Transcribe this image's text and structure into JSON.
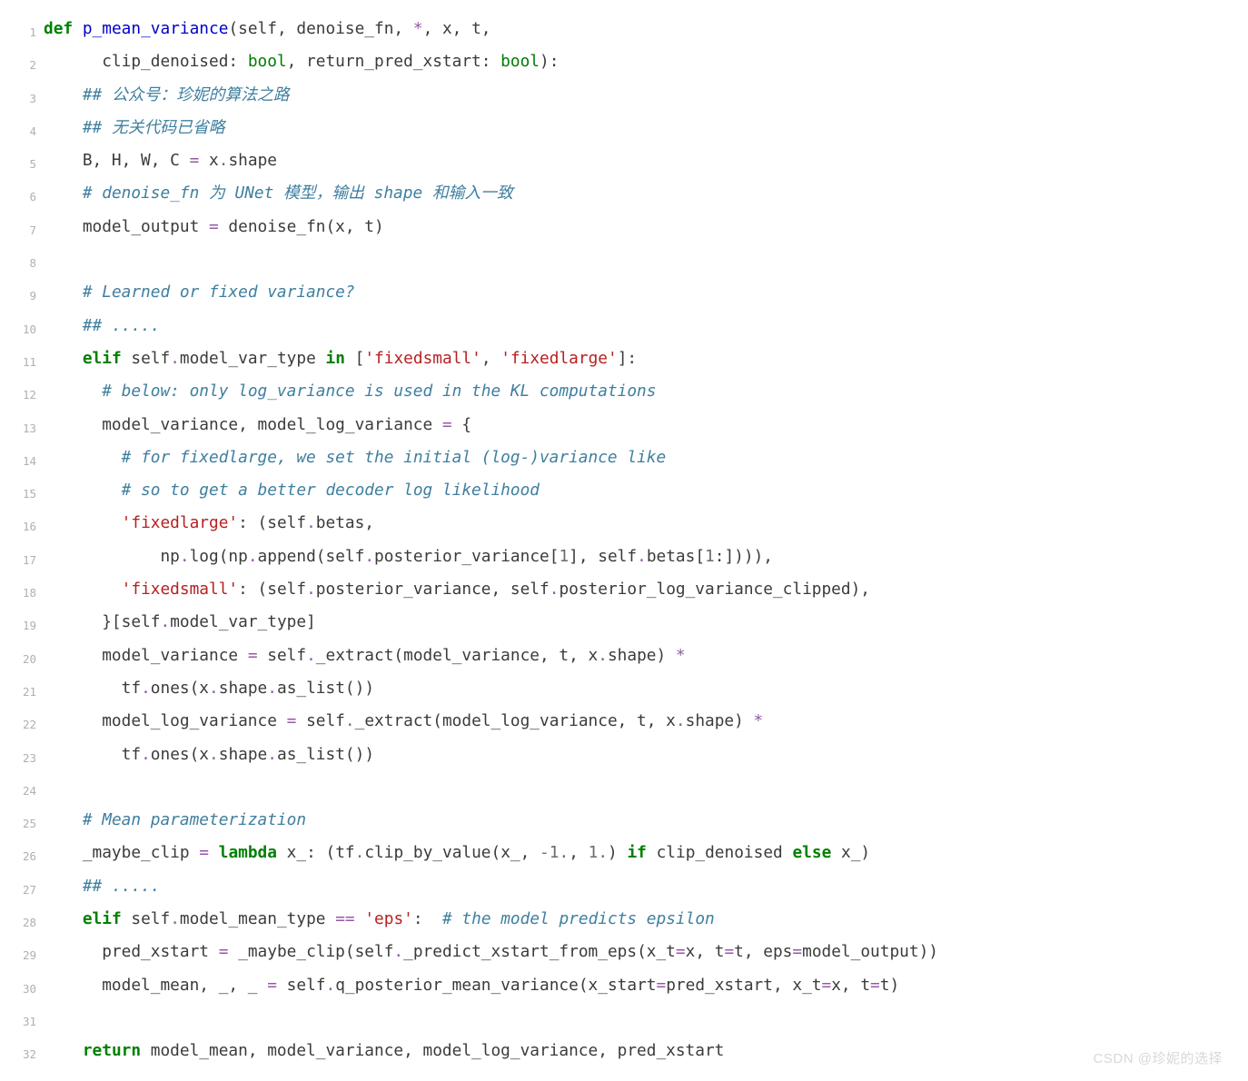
{
  "watermark": "CSDN @珍妮的选择",
  "lines": [
    {
      "n": "1",
      "segs": [
        {
          "c": "tok-kw",
          "t": "def"
        },
        {
          "c": "tok-id",
          "t": " "
        },
        {
          "c": "tok-fn",
          "t": "p_mean_variance"
        },
        {
          "c": "tok-id",
          "t": "(self, denoise_fn, "
        },
        {
          "c": "tok-op",
          "t": "*"
        },
        {
          "c": "tok-id",
          "t": ", x, t,"
        }
      ]
    },
    {
      "n": "2",
      "segs": [
        {
          "c": "tok-id",
          "t": "      clip_denoised: "
        },
        {
          "c": "tok-typ",
          "t": "bool"
        },
        {
          "c": "tok-id",
          "t": ", return_pred_xstart: "
        },
        {
          "c": "tok-typ",
          "t": "bool"
        },
        {
          "c": "tok-id",
          "t": "):"
        }
      ]
    },
    {
      "n": "3",
      "segs": [
        {
          "c": "tok-id",
          "t": "    "
        },
        {
          "c": "tok-cmt",
          "t": "## 公众号：珍妮的算法之路"
        }
      ]
    },
    {
      "n": "4",
      "segs": [
        {
          "c": "tok-id",
          "t": "    "
        },
        {
          "c": "tok-cmt",
          "t": "## 无关代码已省略"
        }
      ]
    },
    {
      "n": "5",
      "segs": [
        {
          "c": "tok-id",
          "t": "    B, H, W, C "
        },
        {
          "c": "tok-op",
          "t": "="
        },
        {
          "c": "tok-id",
          "t": " x"
        },
        {
          "c": "tok-op",
          "t": "."
        },
        {
          "c": "tok-id",
          "t": "shape"
        }
      ]
    },
    {
      "n": "6",
      "segs": [
        {
          "c": "tok-id",
          "t": "    "
        },
        {
          "c": "tok-cmt",
          "t": "# denoise_fn 为 UNet 模型，输出 shape 和输入一致"
        }
      ]
    },
    {
      "n": "7",
      "segs": [
        {
          "c": "tok-id",
          "t": "    model_output "
        },
        {
          "c": "tok-op",
          "t": "="
        },
        {
          "c": "tok-id",
          "t": " denoise_fn(x, t)"
        }
      ]
    },
    {
      "n": "8",
      "segs": [
        {
          "c": "tok-id",
          "t": " "
        }
      ]
    },
    {
      "n": "9",
      "segs": [
        {
          "c": "tok-id",
          "t": "    "
        },
        {
          "c": "tok-cmt",
          "t": "# Learned or fixed variance?"
        }
      ]
    },
    {
      "n": "10",
      "segs": [
        {
          "c": "tok-id",
          "t": "    "
        },
        {
          "c": "tok-cmt",
          "t": "## ....."
        }
      ]
    },
    {
      "n": "11",
      "segs": [
        {
          "c": "tok-id",
          "t": "    "
        },
        {
          "c": "tok-kw",
          "t": "elif"
        },
        {
          "c": "tok-id",
          "t": " self"
        },
        {
          "c": "tok-op",
          "t": "."
        },
        {
          "c": "tok-id",
          "t": "model_var_type "
        },
        {
          "c": "tok-kw",
          "t": "in"
        },
        {
          "c": "tok-id",
          "t": " ["
        },
        {
          "c": "tok-str",
          "t": "'fixedsmall'"
        },
        {
          "c": "tok-id",
          "t": ", "
        },
        {
          "c": "tok-str",
          "t": "'fixedlarge'"
        },
        {
          "c": "tok-id",
          "t": "]:"
        }
      ]
    },
    {
      "n": "12",
      "segs": [
        {
          "c": "tok-id",
          "t": "      "
        },
        {
          "c": "tok-cmt",
          "t": "# below: only log_variance is used in the KL computations"
        }
      ]
    },
    {
      "n": "13",
      "segs": [
        {
          "c": "tok-id",
          "t": "      model_variance, model_log_variance "
        },
        {
          "c": "tok-op",
          "t": "="
        },
        {
          "c": "tok-id",
          "t": " {"
        }
      ]
    },
    {
      "n": "14",
      "segs": [
        {
          "c": "tok-id",
          "t": "        "
        },
        {
          "c": "tok-cmt",
          "t": "# for fixedlarge, we set the initial (log-)variance like"
        }
      ]
    },
    {
      "n": "15",
      "segs": [
        {
          "c": "tok-id",
          "t": "        "
        },
        {
          "c": "tok-cmt",
          "t": "# so to get a better decoder log likelihood"
        }
      ]
    },
    {
      "n": "16",
      "segs": [
        {
          "c": "tok-id",
          "t": "        "
        },
        {
          "c": "tok-str",
          "t": "'fixedlarge'"
        },
        {
          "c": "tok-id",
          "t": ": (self"
        },
        {
          "c": "tok-op",
          "t": "."
        },
        {
          "c": "tok-id",
          "t": "betas,"
        }
      ]
    },
    {
      "n": "17",
      "segs": [
        {
          "c": "tok-id",
          "t": "            np"
        },
        {
          "c": "tok-op",
          "t": "."
        },
        {
          "c": "tok-id",
          "t": "log(np"
        },
        {
          "c": "tok-op",
          "t": "."
        },
        {
          "c": "tok-id",
          "t": "append(self"
        },
        {
          "c": "tok-op",
          "t": "."
        },
        {
          "c": "tok-id",
          "t": "posterior_variance["
        },
        {
          "c": "tok-num",
          "t": "1"
        },
        {
          "c": "tok-id",
          "t": "], self"
        },
        {
          "c": "tok-op",
          "t": "."
        },
        {
          "c": "tok-id",
          "t": "betas["
        },
        {
          "c": "tok-num",
          "t": "1"
        },
        {
          "c": "tok-id",
          "t": ":]))),"
        }
      ]
    },
    {
      "n": "18",
      "segs": [
        {
          "c": "tok-id",
          "t": "        "
        },
        {
          "c": "tok-str",
          "t": "'fixedsmall'"
        },
        {
          "c": "tok-id",
          "t": ": (self"
        },
        {
          "c": "tok-op",
          "t": "."
        },
        {
          "c": "tok-id",
          "t": "posterior_variance, self"
        },
        {
          "c": "tok-op",
          "t": "."
        },
        {
          "c": "tok-id",
          "t": "posterior_log_variance_clipped),"
        }
      ]
    },
    {
      "n": "19",
      "segs": [
        {
          "c": "tok-id",
          "t": "      }[self"
        },
        {
          "c": "tok-op",
          "t": "."
        },
        {
          "c": "tok-id",
          "t": "model_var_type]"
        }
      ]
    },
    {
      "n": "20",
      "segs": [
        {
          "c": "tok-id",
          "t": "      model_variance "
        },
        {
          "c": "tok-op",
          "t": "="
        },
        {
          "c": "tok-id",
          "t": " self"
        },
        {
          "c": "tok-op",
          "t": "."
        },
        {
          "c": "tok-id",
          "t": "_extract(model_variance, t, x"
        },
        {
          "c": "tok-op",
          "t": "."
        },
        {
          "c": "tok-id",
          "t": "shape) "
        },
        {
          "c": "tok-op",
          "t": "*"
        }
      ]
    },
    {
      "n": "21",
      "segs": [
        {
          "c": "tok-id",
          "t": "        tf"
        },
        {
          "c": "tok-op",
          "t": "."
        },
        {
          "c": "tok-id",
          "t": "ones(x"
        },
        {
          "c": "tok-op",
          "t": "."
        },
        {
          "c": "tok-id",
          "t": "shape"
        },
        {
          "c": "tok-op",
          "t": "."
        },
        {
          "c": "tok-id",
          "t": "as_list())"
        }
      ]
    },
    {
      "n": "22",
      "segs": [
        {
          "c": "tok-id",
          "t": "      model_log_variance "
        },
        {
          "c": "tok-op",
          "t": "="
        },
        {
          "c": "tok-id",
          "t": " self"
        },
        {
          "c": "tok-op",
          "t": "."
        },
        {
          "c": "tok-id",
          "t": "_extract(model_log_variance, t, x"
        },
        {
          "c": "tok-op",
          "t": "."
        },
        {
          "c": "tok-id",
          "t": "shape) "
        },
        {
          "c": "tok-op",
          "t": "*"
        }
      ]
    },
    {
      "n": "23",
      "segs": [
        {
          "c": "tok-id",
          "t": "        tf"
        },
        {
          "c": "tok-op",
          "t": "."
        },
        {
          "c": "tok-id",
          "t": "ones(x"
        },
        {
          "c": "tok-op",
          "t": "."
        },
        {
          "c": "tok-id",
          "t": "shape"
        },
        {
          "c": "tok-op",
          "t": "."
        },
        {
          "c": "tok-id",
          "t": "as_list())"
        }
      ]
    },
    {
      "n": "24",
      "segs": [
        {
          "c": "tok-id",
          "t": " "
        }
      ]
    },
    {
      "n": "25",
      "segs": [
        {
          "c": "tok-id",
          "t": "    "
        },
        {
          "c": "tok-cmt",
          "t": "# Mean parameterization"
        }
      ]
    },
    {
      "n": "26",
      "segs": [
        {
          "c": "tok-id",
          "t": "    _maybe_clip "
        },
        {
          "c": "tok-op",
          "t": "="
        },
        {
          "c": "tok-id",
          "t": " "
        },
        {
          "c": "tok-kw",
          "t": "lambda"
        },
        {
          "c": "tok-id",
          "t": " x_: (tf"
        },
        {
          "c": "tok-op",
          "t": "."
        },
        {
          "c": "tok-id",
          "t": "clip_by_value(x_, "
        },
        {
          "c": "tok-op",
          "t": "-"
        },
        {
          "c": "tok-num",
          "t": "1."
        },
        {
          "c": "tok-id",
          "t": ", "
        },
        {
          "c": "tok-num",
          "t": "1."
        },
        {
          "c": "tok-id",
          "t": ") "
        },
        {
          "c": "tok-kw",
          "t": "if"
        },
        {
          "c": "tok-id",
          "t": " clip_denoised "
        },
        {
          "c": "tok-kw",
          "t": "else"
        },
        {
          "c": "tok-id",
          "t": " x_)"
        }
      ]
    },
    {
      "n": "27",
      "segs": [
        {
          "c": "tok-id",
          "t": "    "
        },
        {
          "c": "tok-cmt",
          "t": "## ....."
        }
      ]
    },
    {
      "n": "28",
      "segs": [
        {
          "c": "tok-id",
          "t": "    "
        },
        {
          "c": "tok-kw",
          "t": "elif"
        },
        {
          "c": "tok-id",
          "t": " self"
        },
        {
          "c": "tok-op",
          "t": "."
        },
        {
          "c": "tok-id",
          "t": "model_mean_type "
        },
        {
          "c": "tok-op",
          "t": "=="
        },
        {
          "c": "tok-id",
          "t": " "
        },
        {
          "c": "tok-str",
          "t": "'eps'"
        },
        {
          "c": "tok-id",
          "t": ":  "
        },
        {
          "c": "tok-cmt",
          "t": "# the model predicts epsilon"
        }
      ]
    },
    {
      "n": "29",
      "segs": [
        {
          "c": "tok-id",
          "t": "      pred_xstart "
        },
        {
          "c": "tok-op",
          "t": "="
        },
        {
          "c": "tok-id",
          "t": " _maybe_clip(self"
        },
        {
          "c": "tok-op",
          "t": "."
        },
        {
          "c": "tok-id",
          "t": "_predict_xstart_from_eps(x_t"
        },
        {
          "c": "tok-op",
          "t": "="
        },
        {
          "c": "tok-id",
          "t": "x, t"
        },
        {
          "c": "tok-op",
          "t": "="
        },
        {
          "c": "tok-id",
          "t": "t, eps"
        },
        {
          "c": "tok-op",
          "t": "="
        },
        {
          "c": "tok-id",
          "t": "model_output))"
        }
      ]
    },
    {
      "n": "30",
      "segs": [
        {
          "c": "tok-id",
          "t": "      model_mean, _, _ "
        },
        {
          "c": "tok-op",
          "t": "="
        },
        {
          "c": "tok-id",
          "t": " self"
        },
        {
          "c": "tok-op",
          "t": "."
        },
        {
          "c": "tok-id",
          "t": "q_posterior_mean_variance(x_start"
        },
        {
          "c": "tok-op",
          "t": "="
        },
        {
          "c": "tok-id",
          "t": "pred_xstart, x_t"
        },
        {
          "c": "tok-op",
          "t": "="
        },
        {
          "c": "tok-id",
          "t": "x, t"
        },
        {
          "c": "tok-op",
          "t": "="
        },
        {
          "c": "tok-id",
          "t": "t)"
        }
      ]
    },
    {
      "n": "31",
      "segs": [
        {
          "c": "tok-id",
          "t": " "
        }
      ]
    },
    {
      "n": "32",
      "segs": [
        {
          "c": "tok-id",
          "t": "    "
        },
        {
          "c": "tok-kw",
          "t": "return"
        },
        {
          "c": "tok-id",
          "t": " model_mean, model_variance, model_log_variance, pred_xstart"
        }
      ]
    }
  ]
}
